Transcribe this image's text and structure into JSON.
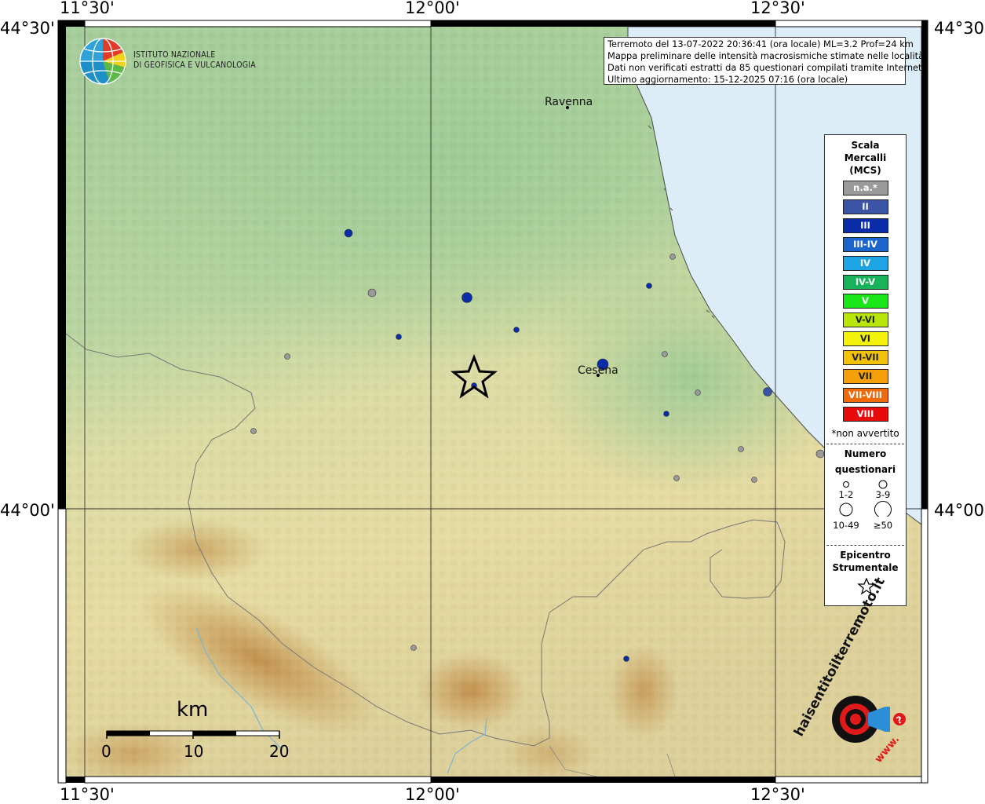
{
  "coords": {
    "top": [
      "11°30'",
      "12°00'",
      "12°30'"
    ],
    "bottom": [
      "11°30'",
      "12°00'",
      "12°30'"
    ],
    "left": [
      "44°30'",
      "44°00'"
    ],
    "right": [
      "44°30'",
      "44°00'"
    ]
  },
  "institute": {
    "line1": "ISTITUTO NAZIONALE",
    "line2": "DI GEOFISICA E VULCANOLOGIA"
  },
  "info": {
    "line1": "Terremoto del 13-07-2022 20:36:41 (ora locale) ML=3.2 Prof=24 km",
    "line2": "Mappa preliminare delle intensità macrosismiche stimate nelle località",
    "line3": "Dati non verificati estratti da 85 questionari compilati tramite Internet.",
    "line4": "Ultimo aggiornamento: 15-12-2025 07:16 (ora locale)"
  },
  "cities": [
    {
      "name": "Ravenna"
    },
    {
      "name": "Cesena"
    }
  ],
  "legend": {
    "title1": "Scala",
    "title2": "Mercalli",
    "title3": "(MCS)",
    "items": [
      {
        "label": "n.a.*",
        "color": "#9a9a9a"
      },
      {
        "label": "II",
        "color": "#3c54a8"
      },
      {
        "label": "III",
        "color": "#0a2ca8"
      },
      {
        "label": "III-IV",
        "color": "#1a66cc"
      },
      {
        "label": "IV",
        "color": "#1ea3e4"
      },
      {
        "label": "IV-V",
        "color": "#17b35a"
      },
      {
        "label": "V",
        "color": "#19e619"
      },
      {
        "label": "V-VI",
        "color": "#b8e60a"
      },
      {
        "label": "VI",
        "color": "#f2f20a"
      },
      {
        "label": "VI-VII",
        "color": "#f5c20a"
      },
      {
        "label": "VII",
        "color": "#f5a00a"
      },
      {
        "label": "VII-VIII",
        "color": "#f06a0a"
      },
      {
        "label": "VIII",
        "color": "#e60a0a"
      }
    ],
    "note": "*non avvertito",
    "count_title1": "Numero",
    "count_title2": "questionari",
    "counts": [
      "1-2",
      "3-9",
      "10-49",
      "≥50"
    ],
    "epi_title1": "Epicentro",
    "epi_title2": "Strumentale"
  },
  "scale": {
    "unit": "km",
    "ticks": [
      "0",
      "10",
      "20"
    ]
  },
  "badge": {
    "text_main": "haisentitoilterremoto.it",
    "text_url": "www.",
    "colors": {
      "red": "#e01a1a",
      "black": "#111111",
      "blue": "#2a8fd6"
    }
  },
  "colors": {
    "plain": "#a9cf9e",
    "sea": "#dcedf8",
    "hill": "#e3dfa0",
    "mountain": "#c79a52"
  }
}
